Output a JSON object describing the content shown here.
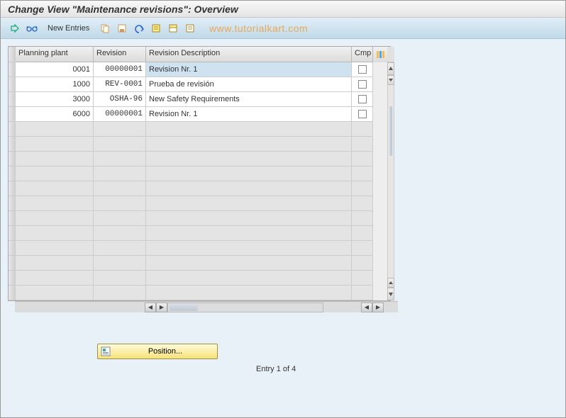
{
  "header": {
    "title": "Change View \"Maintenance revisions\": Overview"
  },
  "watermark": "www.tutorialkart.com",
  "toolbar": {
    "new_entries": "New Entries"
  },
  "table": {
    "headers": {
      "plant": "Planning plant",
      "revision": "Revision",
      "desc": "Revision Description",
      "cmp": "Cmp"
    },
    "rows": [
      {
        "plant": "0001",
        "revision": "00000001",
        "desc": "Revision Nr. 1",
        "selected": true
      },
      {
        "plant": "1000",
        "revision": "REV-0001",
        "desc": "Prueba de revisión",
        "selected": false
      },
      {
        "plant": "3000",
        "revision": "OSHA-96 ",
        "desc": "New Safety Requirements",
        "selected": false
      },
      {
        "plant": "6000",
        "revision": "00000001",
        "desc": "Revision Nr. 1",
        "selected": false
      }
    ],
    "empty_row_count": 12
  },
  "position_button": {
    "label": "Position..."
  },
  "status": {
    "entry_text": "Entry 1 of 4"
  }
}
